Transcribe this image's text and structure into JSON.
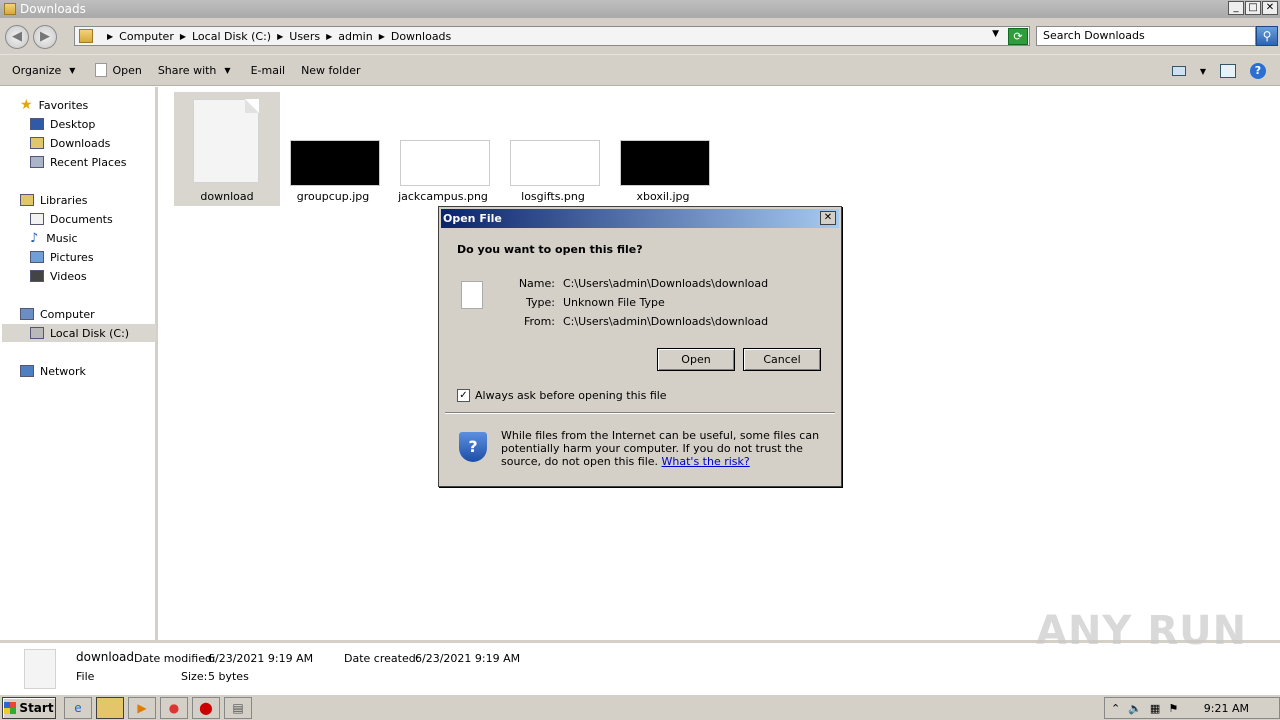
{
  "window": {
    "title": "Downloads"
  },
  "address": {
    "crumbs": [
      "Computer",
      "Local Disk (C:)",
      "Users",
      "admin",
      "Downloads"
    ],
    "search_placeholder": "Search Downloads"
  },
  "toolbar": {
    "organize": "Organize",
    "open": "Open",
    "share_with": "Share with",
    "email": "E-mail",
    "new_folder": "New folder"
  },
  "nav": {
    "favorites": "Favorites",
    "desktop": "Desktop",
    "downloads": "Downloads",
    "recent": "Recent Places",
    "libraries": "Libraries",
    "documents": "Documents",
    "music": "Music",
    "pictures": "Pictures",
    "videos": "Videos",
    "computer": "Computer",
    "local_disk": "Local Disk (C:)",
    "network": "Network"
  },
  "files": [
    {
      "name": "download",
      "thumb": "generic-file-icon",
      "bg": ""
    },
    {
      "name": "groupcup.jpg",
      "thumb": "image-thumbnail",
      "bg": "#000000"
    },
    {
      "name": "jackcampus.png",
      "thumb": "image-thumbnail",
      "bg": "#ffffff"
    },
    {
      "name": "losgifts.png",
      "thumb": "image-thumbnail",
      "bg": "#ffffff"
    },
    {
      "name": "xboxil.jpg",
      "thumb": "image-thumbnail",
      "bg": "#000000"
    }
  ],
  "dialog": {
    "title": "Open File",
    "question": "Do you want to open this file?",
    "name_label": "Name:",
    "name_value": "C:\\Users\\admin\\Downloads\\download",
    "type_label": "Type:",
    "type_value": "Unknown File Type",
    "from_label": "From:",
    "from_value": "C:\\Users\\admin\\Downloads\\download",
    "open_btn": "Open",
    "cancel_btn": "Cancel",
    "checkbox_label": "Always ask before opening this file",
    "checkbox_checked": true,
    "warning": "While files from the Internet can be useful, some files can potentially harm your computer. If you do not trust the source, do not open this file.",
    "risk_link": "What's the risk?"
  },
  "details": {
    "name": "download",
    "kind": "File",
    "modified_label": "Date modified:",
    "modified_value": "6/23/2021 9:19 AM",
    "created_label": "Date created:",
    "created_value": "6/23/2021 9:19 AM",
    "size_label": "Size:",
    "size_value": "5 bytes"
  },
  "watermark": "ANY RUN",
  "taskbar": {
    "start": "Start",
    "clock": "9:21 AM"
  }
}
